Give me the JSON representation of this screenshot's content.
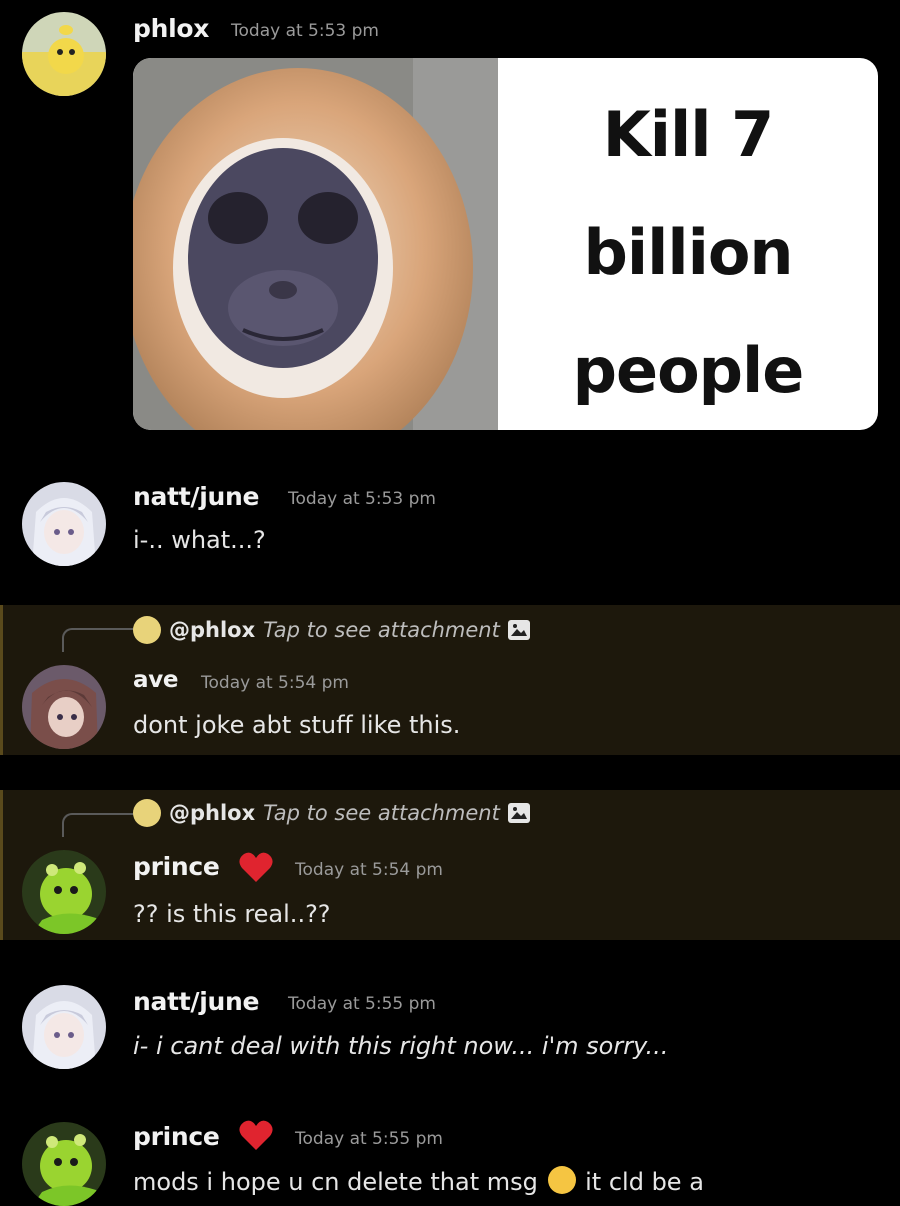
{
  "messages": [
    {
      "user": "phlox",
      "time": "Today at 5:53 pm",
      "meme_text": "Kill 7 billion people"
    },
    {
      "user": "natt/june",
      "time": "Today at 5:53 pm",
      "text": "i-.. what...?"
    },
    {
      "reply": {
        "mention": "@phlox",
        "tap": "Tap to see attachment"
      },
      "user": "ave",
      "time": "Today at 5:54 pm",
      "text": "dont joke abt stuff like this."
    },
    {
      "reply": {
        "mention": "@phlox",
        "tap": "Tap to see attachment"
      },
      "user": "prince",
      "time": "Today at 5:54 pm",
      "text": "?? is this real..??"
    },
    {
      "user": "natt/june",
      "time": "Today at 5:55 pm",
      "text": "i- i cant deal with this right now... i'm sorry..."
    },
    {
      "user": "prince",
      "time": "Today at 5:55 pm",
      "text_before": "mods i hope u cn delete that msg",
      "text_after": "it cld be a"
    }
  ],
  "meme_lines": [
    "Kill 7",
    "billion",
    "people"
  ],
  "icons": {
    "heart": "heart-icon",
    "image": "image-attachment-icon",
    "emoji": "crying-face-emoji"
  },
  "colors": {
    "background": "#000000",
    "reply_highlight": "#1d180c",
    "heart": "#e0242f"
  }
}
